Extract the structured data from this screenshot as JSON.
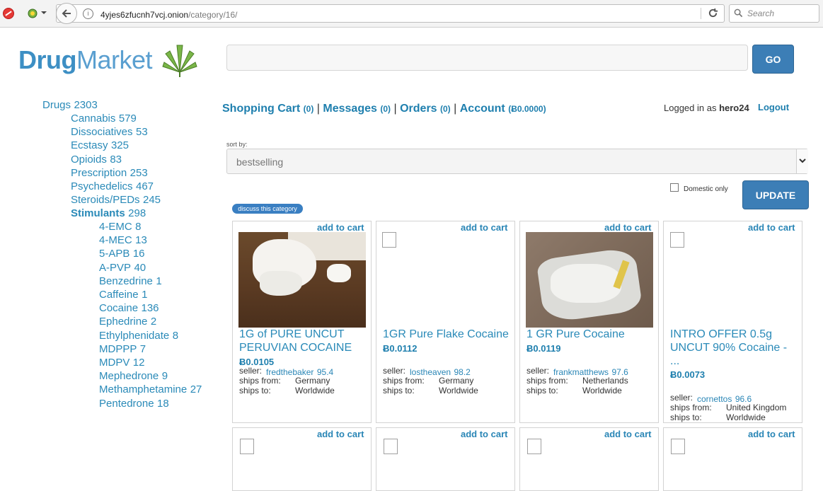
{
  "browser": {
    "url_host": "4yjes6zfucnh7vcj.onion",
    "url_path": "/category/16/",
    "search_placeholder": "Search"
  },
  "site": {
    "logo_part1": "Drug",
    "logo_part2": "Market",
    "go_label": "GO"
  },
  "sidebar": {
    "root": {
      "label": "Drugs",
      "count": "2303"
    },
    "categories": [
      {
        "label": "Cannabis",
        "count": "579"
      },
      {
        "label": "Dissociatives",
        "count": "53"
      },
      {
        "label": "Ecstasy",
        "count": "325"
      },
      {
        "label": "Opioids",
        "count": "83"
      },
      {
        "label": "Prescription",
        "count": "253"
      },
      {
        "label": "Psychedelics",
        "count": "467"
      },
      {
        "label": "Steroids/PEDs",
        "count": "245"
      },
      {
        "label": "Stimulants",
        "count": "298"
      }
    ],
    "subcategories": [
      {
        "label": "4-EMC",
        "count": "8"
      },
      {
        "label": "4-MEC",
        "count": "13"
      },
      {
        "label": "5-APB",
        "count": "16"
      },
      {
        "label": "A-PVP",
        "count": "40"
      },
      {
        "label": "Benzedrine",
        "count": "1"
      },
      {
        "label": "Caffeine",
        "count": "1"
      },
      {
        "label": "Cocaine",
        "count": "136"
      },
      {
        "label": "Ephedrine",
        "count": "2"
      },
      {
        "label": "Ethylphenidate",
        "count": "8"
      },
      {
        "label": "MDPPP",
        "count": "7"
      },
      {
        "label": "MDPV",
        "count": "12"
      },
      {
        "label": "Mephedrone",
        "count": "9"
      },
      {
        "label": "Methamphetamine",
        "count": "27"
      },
      {
        "label": "Pentedrone",
        "count": "18"
      }
    ]
  },
  "topnav": {
    "cart_label": "Shopping Cart",
    "cart_count": "(0)",
    "messages_label": "Messages",
    "messages_count": "(0)",
    "orders_label": "Orders",
    "orders_count": "(0)",
    "account_label": "Account",
    "account_balance": "(Ƀ0.0000)",
    "separator": "|",
    "logged_in_prefix": "Logged in as",
    "username": "hero24",
    "logout_label": "Logout"
  },
  "filters": {
    "sort_label": "sort by:",
    "sort_value": "bestselling",
    "domestic_label": "Domestic only",
    "update_label": "UPDATE",
    "discuss_label": "discuss this category"
  },
  "products": [
    {
      "add_to_cart": "add to cart",
      "title_line1": "1G of PURE UNCUT",
      "title_line2": "PERUVIAN COCAINE",
      "title_line3": "",
      "price": "Ƀ0.0105",
      "seller_label": "seller:",
      "seller": "fredthebaker",
      "rating": "95.4",
      "ships_from_label": "ships from:",
      "ships_from": "Germany",
      "ships_to_label": "ships to:",
      "ships_to": "Worldwide"
    },
    {
      "add_to_cart": "add to cart",
      "title_line1": "1GR Pure Flake Cocaine",
      "title_line2": "",
      "title_line3": "",
      "price": "Ƀ0.0112",
      "seller_label": "seller:",
      "seller": "lostheaven",
      "rating": "98.2",
      "ships_from_label": "ships from:",
      "ships_from": "Germany",
      "ships_to_label": "ships to:",
      "ships_to": "Worldwide"
    },
    {
      "add_to_cart": "add to cart",
      "title_line1": "1 GR Pure Cocaine",
      "title_line2": "",
      "title_line3": "",
      "price": "Ƀ0.0119",
      "seller_label": "seller:",
      "seller": "frankmatthews",
      "rating": "97.6",
      "ships_from_label": "ships from:",
      "ships_from": "Netherlands",
      "ships_to_label": "ships to:",
      "ships_to": "Worldwide"
    },
    {
      "add_to_cart": "add to cart",
      "title_line1": "INTRO OFFER 0.5g",
      "title_line2": "UNCUT 90% Cocaine -",
      "title_line3": "...",
      "price": "Ƀ0.0073",
      "seller_label": "seller:",
      "seller": "cornettos",
      "rating": "96.6",
      "ships_from_label": "ships from:",
      "ships_from": "United Kingdom",
      "ships_to_label": "ships to:",
      "ships_to": "Worldwide"
    }
  ],
  "products_row2": [
    {
      "add_to_cart": "add to cart"
    },
    {
      "add_to_cart": "add to cart"
    },
    {
      "add_to_cart": "add to cart"
    },
    {
      "add_to_cart": "add to cart"
    }
  ]
}
